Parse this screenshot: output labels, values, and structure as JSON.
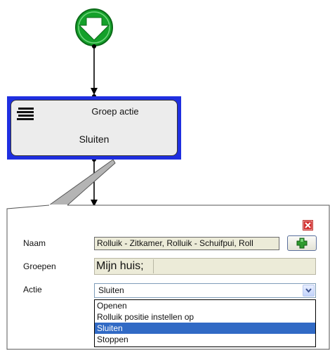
{
  "node": {
    "title": "Groep actie",
    "value": "Sluiten"
  },
  "form": {
    "naam_label": "Naam",
    "naam_value": "Rolluik - Zitkamer, Rolluik - Schuifpui, Roll",
    "groepen_label": "Groepen",
    "groepen_value": "Mijn huis;",
    "actie_label": "Actie",
    "actie_selected": "Sluiten",
    "actie_options": [
      "Openen",
      "Rolluik positie instellen op",
      "Sluiten",
      "Stoppen"
    ],
    "actie_highlighted_index": 2
  },
  "icons": {
    "start": "start-down-arrow-icon",
    "node": "list-lines-icon",
    "add": "green-plus-icon",
    "close": "red-x-icon",
    "dropdown": "chevron-down-icon"
  },
  "colors": {
    "start_green": "#14a02a",
    "selection_blue": "#1f2fe0",
    "highlight": "#316ac5",
    "close_red": "#d22c2c"
  }
}
